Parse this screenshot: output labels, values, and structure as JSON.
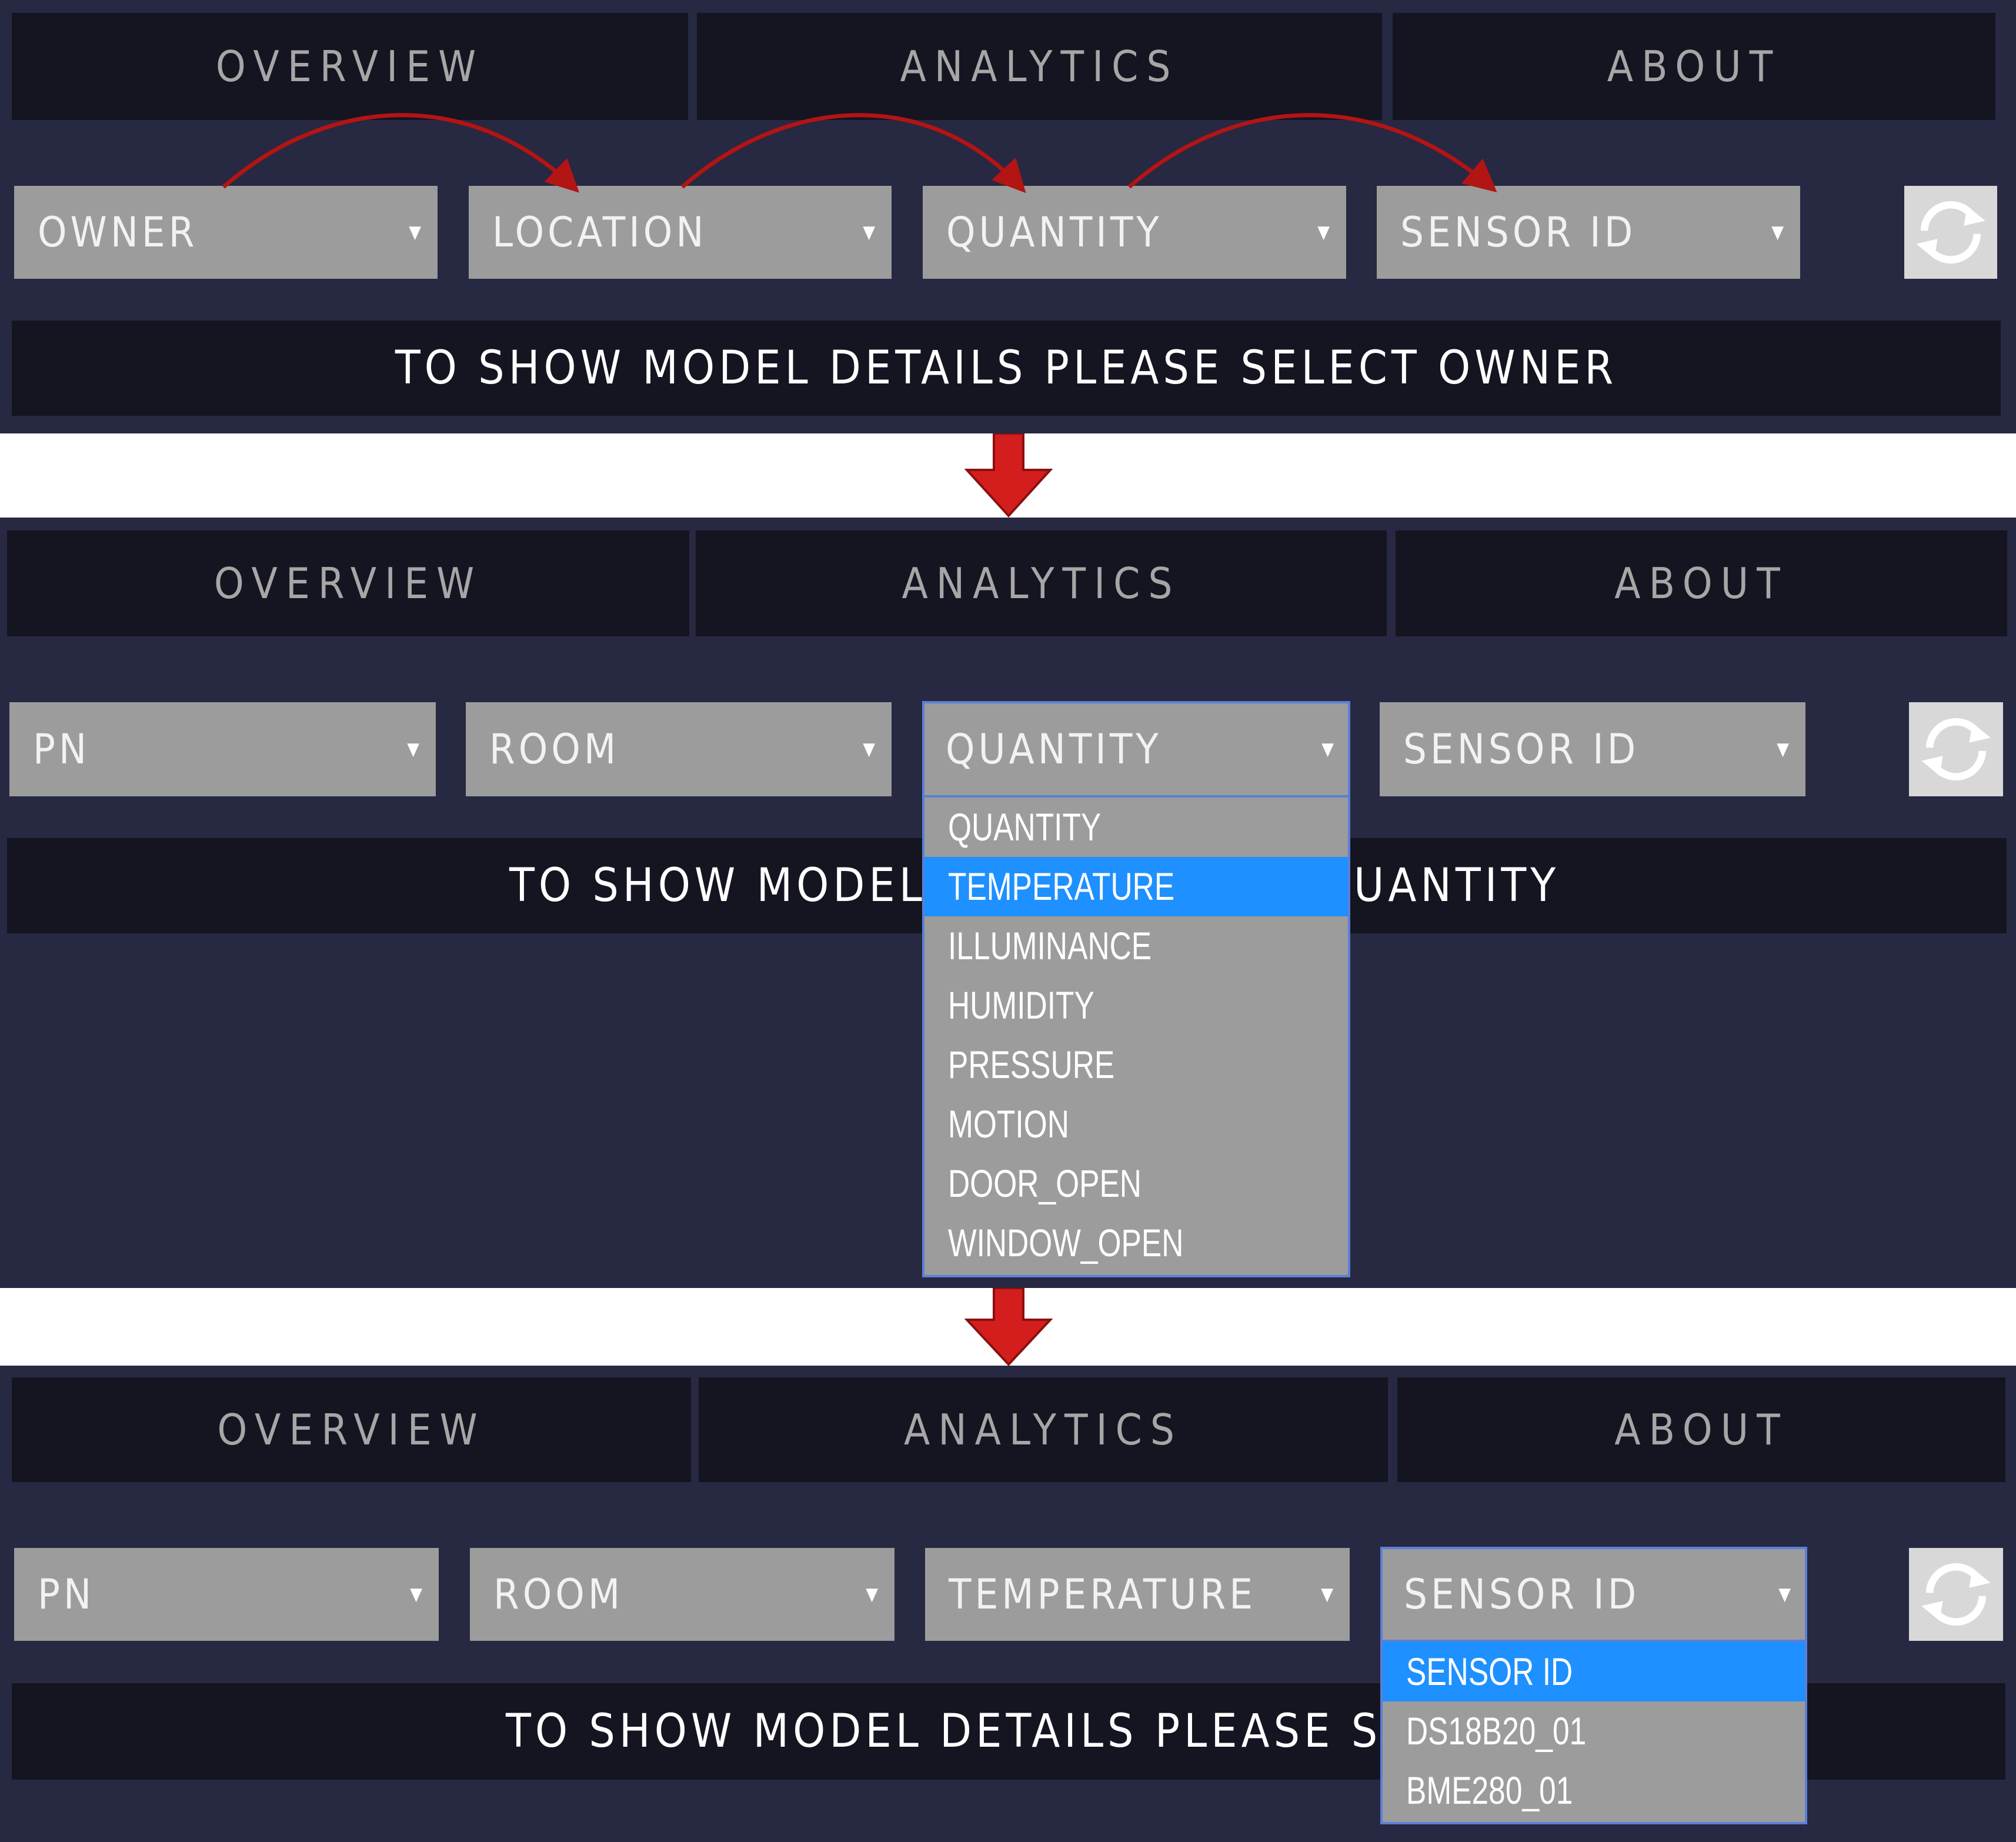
{
  "colors": {
    "panel_bg": "#272841",
    "tab_bg": "#141521",
    "select_bg": "#9c9c9c",
    "highlight": "#1e90ff",
    "arrow_red": "#d41e1e",
    "flow_arrow": "#b31414"
  },
  "panel1": {
    "tabs": [
      "OVERVIEW",
      "ANALYTICS",
      "ABOUT"
    ],
    "selects": [
      "OWNER",
      "LOCATION",
      "QUANTITY",
      "SENSOR ID"
    ],
    "message": "TO SHOW MODEL DETAILS PLEASE SELECT OWNER"
  },
  "panel2": {
    "tabs": [
      "OVERVIEW",
      "ANALYTICS",
      "ABOUT"
    ],
    "selects": [
      "PN",
      "ROOM",
      "QUANTITY",
      "SENSOR ID"
    ],
    "message_left": "TO SHOW MODEL DETA",
    "message_right": "UANTITY",
    "dropdown_options": [
      "QUANTITY",
      "TEMPERATURE",
      "ILLUMINANCE",
      "HUMIDITY",
      "PRESSURE",
      "MOTION",
      "DOOR_OPEN",
      "WINDOW_OPEN"
    ],
    "highlighted_option": "TEMPERATURE"
  },
  "panel3": {
    "tabs": [
      "OVERVIEW",
      "ANALYTICS",
      "ABOUT"
    ],
    "selects": [
      "PN",
      "ROOM",
      "TEMPERATURE",
      "SENSOR ID"
    ],
    "message_left": "TO SHOW MODEL DETAILS PLEASE SELECT SEN",
    "dropdown_options": [
      "SENSOR ID",
      "DS18B20_01",
      "BME280_01"
    ],
    "highlighted_option": "SENSOR ID"
  },
  "icons": {
    "refresh": "refresh-icon",
    "caret": "caret-down-icon",
    "step_arrow": "arrow-down-icon",
    "flow_arrow": "curved-arrow-icon"
  }
}
